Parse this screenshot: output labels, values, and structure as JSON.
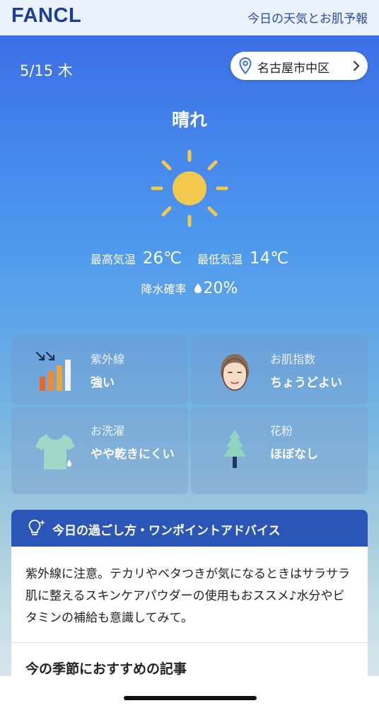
{
  "header": {
    "logo": "FANCL",
    "title": "今日の天気とお肌予報"
  },
  "weather": {
    "date": "5/15 木",
    "location": "名古屋市中区",
    "condition": "晴れ",
    "high_label": "最高気温",
    "high_value": "26℃",
    "low_label": "最低気温",
    "low_value": "14℃",
    "rain_label": "降水確率",
    "rain_value": "20%"
  },
  "cards": [
    {
      "title": "紫外線",
      "value": "強い",
      "icon": "uv-bar-icon"
    },
    {
      "title": "お肌指数",
      "value": "ちょうどよい",
      "icon": "face-icon"
    },
    {
      "title": "お洗濯",
      "value": "やや乾きにくい",
      "icon": "tshirt-icon"
    },
    {
      "title": "花粉",
      "value": "ほぼなし",
      "icon": "tree-icon"
    }
  ],
  "advice": {
    "title": "今日の過ごし方・ワンポイントアドバイス",
    "body": "紫外線に注意。テカリやベタつきが気になるときはサラサラ肌に整えるスキンケアパウダーの使用もおススメ♪水分やビタミンの補給も意識してみて。",
    "section_title": "今の季節におすすめの記事"
  },
  "colors": {
    "brand": "#1e3c9a",
    "header_bar": "#2b56b8",
    "sun": "#f2c94c"
  }
}
